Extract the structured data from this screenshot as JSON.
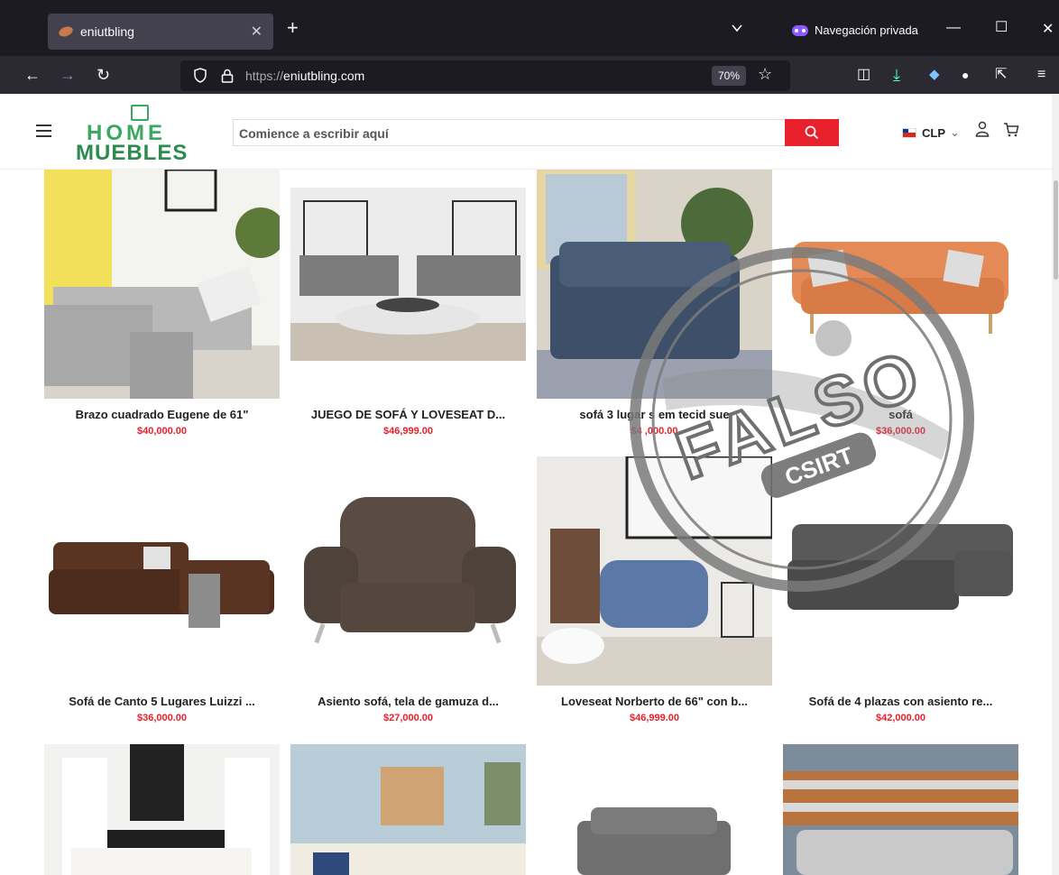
{
  "browser": {
    "tab_title": "eniutbling",
    "new_tab": "+",
    "private_label": "Navegación privada",
    "url_proto": "https://",
    "url_host": "eniutbling.com",
    "zoom": "70%"
  },
  "site": {
    "logo_line1": "HOME",
    "logo_line2": "MUEBLES",
    "search_placeholder": "Comience a escribir aquí",
    "currency": "CLP"
  },
  "products": [
    {
      "title": "Brazo cuadrado Eugene de 61\"",
      "price": "$40,000.00"
    },
    {
      "title": "JUEGO DE SOFÁ Y LOVESEAT D...",
      "price": "$46,999.00"
    },
    {
      "title": "sofá 3 lugar  s em  tecid   sue",
      "price": "$4  ,000.00"
    },
    {
      "title": "sofá",
      "price": "$36,000.00"
    },
    {
      "title": "Sofá de Canto 5 Lugares Luizzi ...",
      "price": "$36,000.00"
    },
    {
      "title": "Asiento sofá, tela de gamuza d...",
      "price": "$27,000.00"
    },
    {
      "title": "Loveseat Norberto de 66\" con b...",
      "price": "$46,999.00"
    },
    {
      "title": "Sofá de 4 plazas con asiento re...",
      "price": "$42,000.00"
    }
  ],
  "stamp": {
    "word": "FALSO",
    "org": "CSIRT"
  },
  "colors": {
    "accent": "#e8202c",
    "brand": "#3aa860"
  }
}
